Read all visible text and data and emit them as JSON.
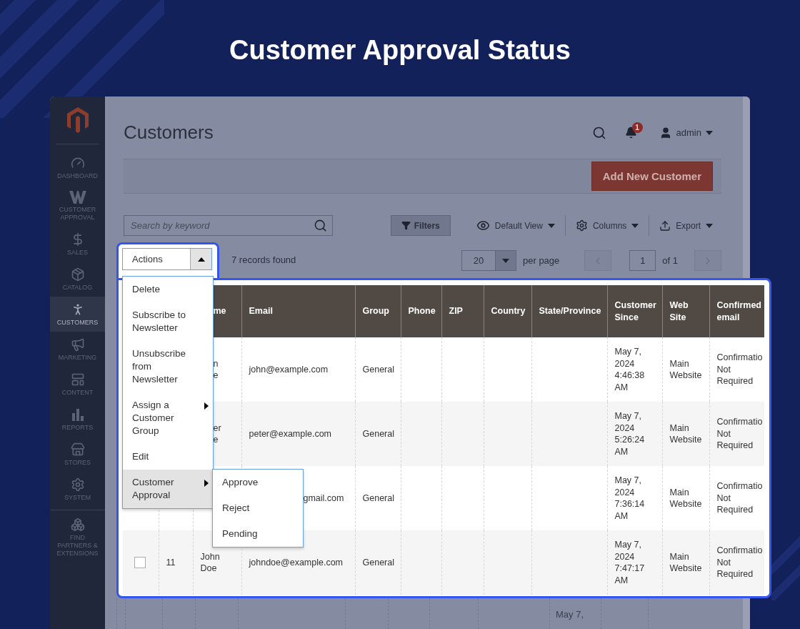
{
  "page_title": "Customer Approval Status",
  "sidebar": {
    "items": [
      {
        "label": "DASHBOARD",
        "selected": false
      },
      {
        "label": "CUSTOMER APPROVAL",
        "selected": false
      },
      {
        "label": "SALES",
        "selected": false
      },
      {
        "label": "CATALOG",
        "selected": false
      },
      {
        "label": "CUSTOMERS",
        "selected": true
      },
      {
        "label": "MARKETING",
        "selected": false
      },
      {
        "label": "CONTENT",
        "selected": false
      },
      {
        "label": "REPORTS",
        "selected": false
      },
      {
        "label": "STORES",
        "selected": false
      },
      {
        "label": "SYSTEM",
        "selected": false
      },
      {
        "label": "FIND PARTNERS & EXTENSIONS",
        "selected": false
      }
    ]
  },
  "header": {
    "title": "Customers",
    "notification_count": "1",
    "user": "admin"
  },
  "add_button": "Add New Customer",
  "toolbar": {
    "search": {
      "placeholder": "Search by keyword"
    },
    "filters": "Filters",
    "view": "Default View",
    "columns": "Columns",
    "export": "Export"
  },
  "actions": {
    "label": "Actions",
    "expanded": true,
    "menu": [
      {
        "label": "Delete",
        "submenu": false,
        "selected": false
      },
      {
        "label": "Subscribe to\nNewsletter",
        "submenu": false,
        "selected": false
      },
      {
        "label": "Unsubscribe\nfrom\nNewsletter",
        "submenu": false,
        "selected": false
      },
      {
        "label": "Assign a\nCustomer\nGroup",
        "submenu": true,
        "selected": false
      },
      {
        "label": "Edit",
        "submenu": false,
        "selected": false
      },
      {
        "label": "Customer\nApproval",
        "submenu": true,
        "selected": true
      }
    ],
    "submenu": [
      {
        "label": "Approve",
        "selected": false
      },
      {
        "label": "Reject",
        "selected": false
      },
      {
        "label": "Pending",
        "selected": false
      }
    ]
  },
  "records_found": "7 records found",
  "pagination": {
    "per_page": "20",
    "per_page_label": "per page",
    "page": "1",
    "page_count": "of 1"
  },
  "table": {
    "columns": [
      {},
      {},
      {
        "label": "me",
        "partial": true
      },
      {
        "label": "Email"
      },
      {
        "label": "Group"
      },
      {
        "label": "Phone"
      },
      {
        "label": "ZIP"
      },
      {
        "label": "Country"
      },
      {
        "label": "State/Province"
      },
      {
        "label": "Customer\nSince"
      },
      {
        "label": "Web\nSite"
      },
      {
        "label": "Confirmed\nemail"
      }
    ],
    "rows": [
      {
        "cells": [
          {},
          {},
          {
            "text": "n\ne",
            "partial": true
          },
          {
            "text": "john@example.com"
          },
          {
            "text": "General"
          },
          {},
          {},
          {},
          {},
          {
            "text": "May 7,\n2024\n4:46:38\nAM"
          },
          {
            "text": "Main\nWebsite"
          },
          {
            "text": "Confirmatio\nNot\nRequired"
          }
        ]
      },
      {
        "cells": [
          {},
          {},
          {
            "text": "er\ne",
            "partial": true
          },
          {
            "text": "peter@example.com"
          },
          {
            "text": "General"
          },
          {},
          {},
          {},
          {},
          {
            "text": "May 7,\n2024\n5:26:24\nAM"
          },
          {
            "text": "Main\nWebsite"
          },
          {
            "text": "Confirmatio\nNot\nRequired"
          }
        ]
      },
      {
        "cells": [
          {},
          {},
          {},
          {
            "text": "gmail.com",
            "partial": true
          },
          {
            "text": "General"
          },
          {},
          {},
          {},
          {},
          {
            "text": "May 7,\n2024\n7:36:14\nAM"
          },
          {
            "text": "Main\nWebsite"
          },
          {
            "text": "Confirmatio\nNot\nRequired"
          }
        ]
      },
      {
        "checkbox": {
          "checked": false
        },
        "cells": [
          {},
          {
            "text": "11"
          },
          {
            "text": "John\nDoe"
          },
          {
            "text": "johndoe@example.com"
          },
          {
            "text": "General"
          },
          {},
          {},
          {},
          {},
          {
            "text": "May 7,\n2024\n7:47:17\nAM"
          },
          {
            "text": "Main\nWebsite"
          },
          {
            "text": "Confirmatio\nNot\nRequired"
          }
        ]
      }
    ]
  },
  "behind_row": {
    "customer_since": "May 7,"
  }
}
